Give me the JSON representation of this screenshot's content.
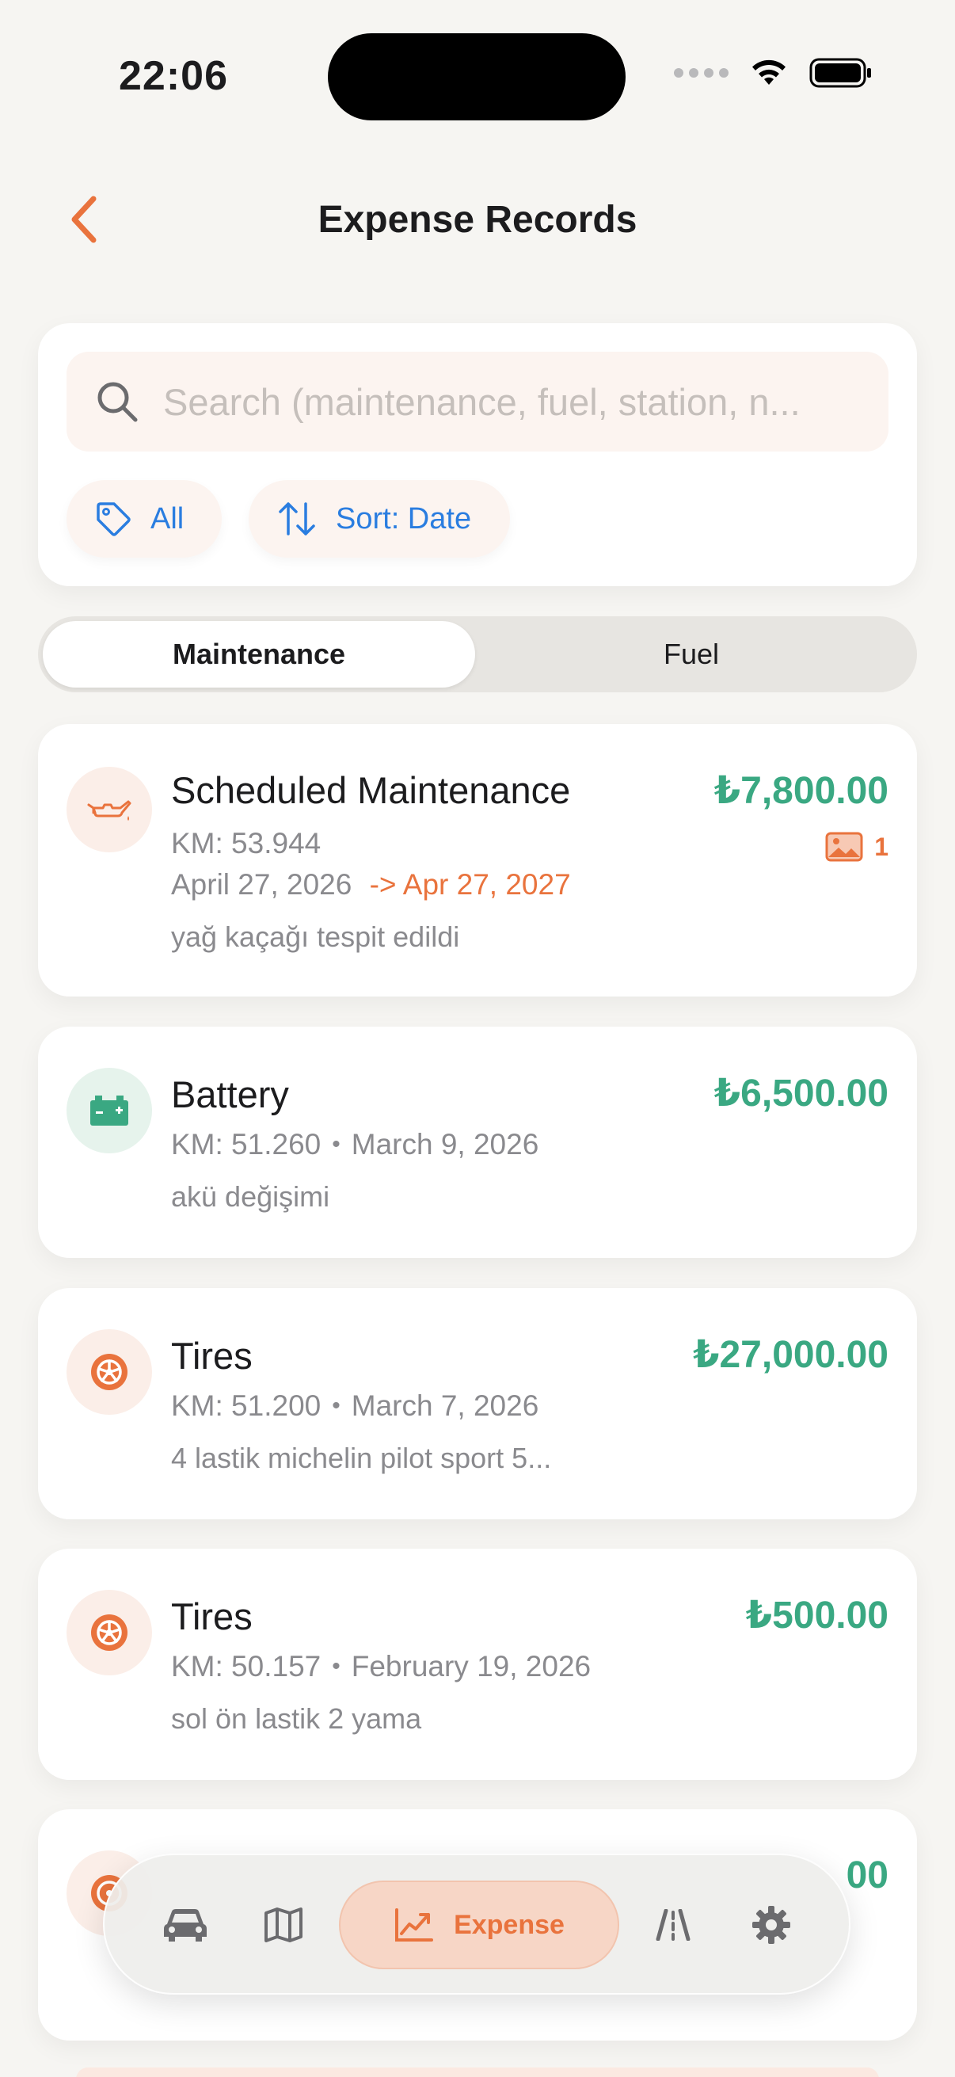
{
  "status_bar": {
    "time": "22:06"
  },
  "header": {
    "title": "Expense Records"
  },
  "search": {
    "placeholder": "Search (maintenance, fuel, station, n...",
    "chips": [
      {
        "label": "All",
        "icon": "tag-icon"
      },
      {
        "label": "Sort: Date",
        "icon": "sort-arrows-icon"
      }
    ]
  },
  "segments": {
    "maintenance": "Maintenance",
    "fuel": "Fuel",
    "selected": "Maintenance"
  },
  "records": [
    {
      "title": "Scheduled Maintenance",
      "amount": "₺7,800.00",
      "km": "KM: 53.944",
      "date": "April 27, 2026",
      "next_due": "-> Apr 27, 2027",
      "note": "yağ kaçağı tespit edildi",
      "photo_count": "1",
      "icon": "oil-can-icon"
    },
    {
      "title": "Battery",
      "amount": "₺6,500.00",
      "km": "KM: 51.260",
      "date": "March 9, 2026",
      "note": "akü değişimi",
      "icon": "battery-icon"
    },
    {
      "title": "Tires",
      "amount": "₺27,000.00",
      "km": "KM: 51.200",
      "date": "March 7, 2026",
      "note": "4 lastik michelin pilot sport 5...",
      "icon": "tire-icon"
    },
    {
      "title": "Tires",
      "amount": "₺500.00",
      "km": "KM: 50.157",
      "date": "February 19, 2026",
      "note": "sol ön lastik 2 yama",
      "icon": "tire-icon"
    },
    {
      "amount_visible_fragment": "00",
      "icon": "tire-icon"
    }
  ],
  "tab_bar": {
    "tabs": [
      {
        "name": "vehicle",
        "icon": "car-icon"
      },
      {
        "name": "map",
        "icon": "map-icon"
      },
      {
        "name": "expense",
        "label": "Expense",
        "icon": "trending-chart-icon",
        "active": true
      },
      {
        "name": "road",
        "icon": "road-icon"
      },
      {
        "name": "settings",
        "icon": "gear-icon"
      }
    ]
  },
  "colors": {
    "accent_orange": "#e9733d",
    "amount_green": "#3aa882",
    "link_blue": "#2a7de0",
    "background": "#f6f5f2"
  }
}
